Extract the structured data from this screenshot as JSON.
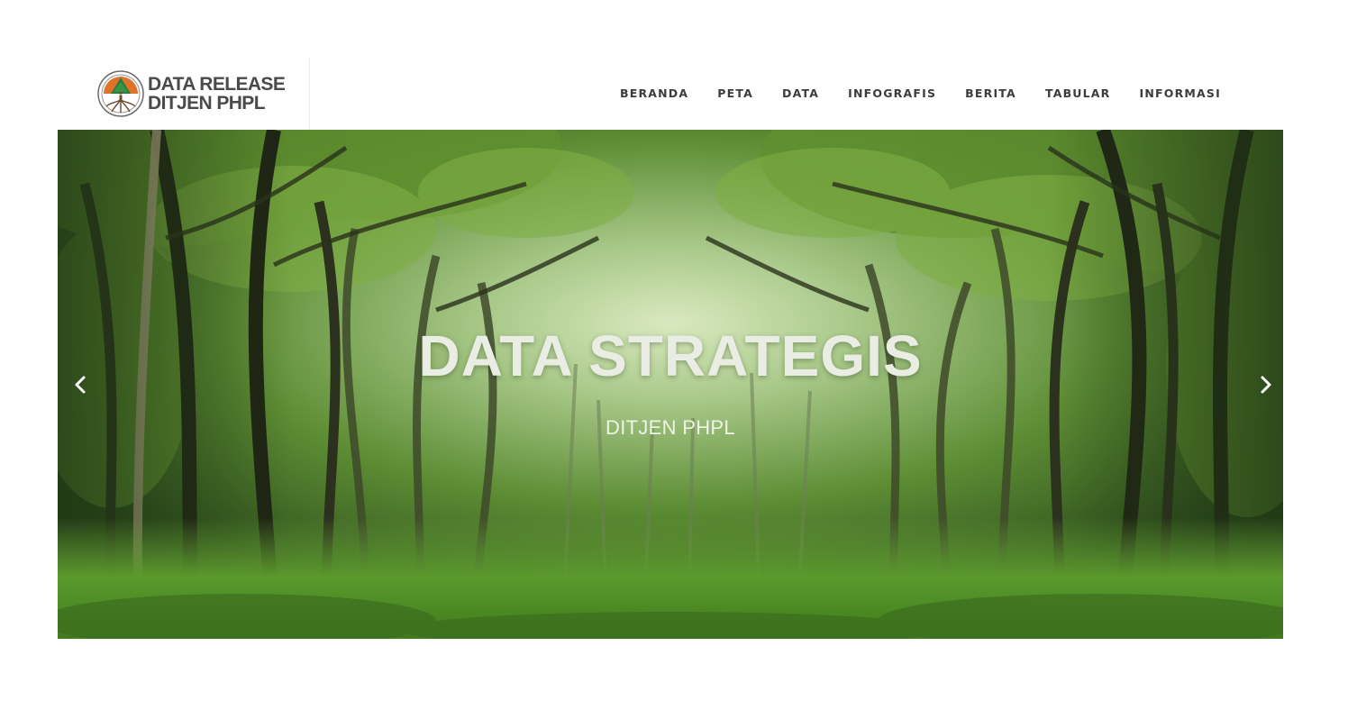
{
  "brand": {
    "line1": "DATA RELEASE",
    "line2": "DITJEN PHPL",
    "logo_icon": "klhk-tree-emblem-icon"
  },
  "nav": {
    "items": [
      {
        "label": "BERANDA"
      },
      {
        "label": "PETA"
      },
      {
        "label": "DATA"
      },
      {
        "label": "INFOGRAFIS"
      },
      {
        "label": "BERITA"
      },
      {
        "label": "TABULAR"
      },
      {
        "label": "INFORMASI"
      }
    ]
  },
  "hero": {
    "title": "DATA STRATEGIS",
    "subtitle": "DITJEN PHPL",
    "prev_icon": "chevron-left-icon",
    "next_icon": "chevron-right-icon"
  },
  "colors": {
    "nav_text": "#3c3c3c",
    "brand_text": "#4a4a4a",
    "forest_light": "#cfe3b0",
    "forest_dark": "#23361a",
    "logo_orange": "#e0722a",
    "logo_green": "#2f7d3a"
  }
}
